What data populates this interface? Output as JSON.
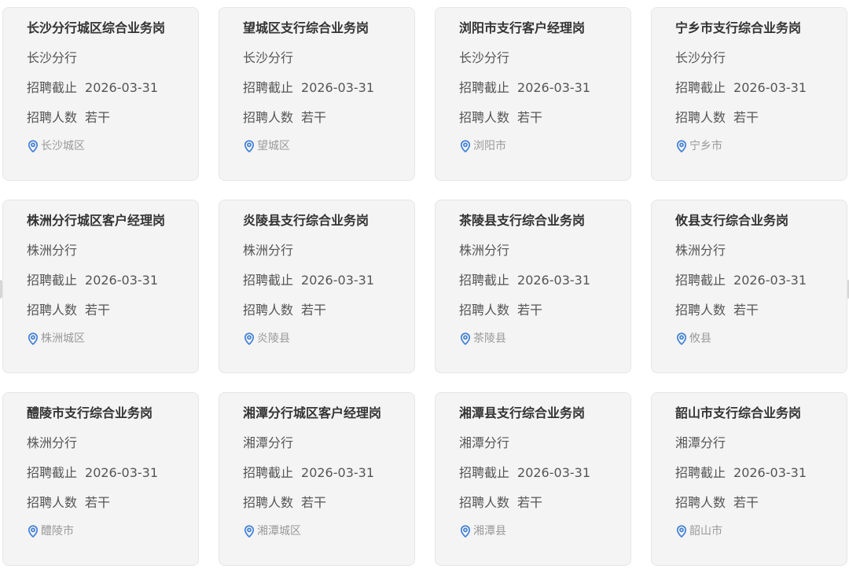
{
  "labels": {
    "deadline": "招聘截止",
    "headcount": "招聘人数"
  },
  "colors": {
    "card_bg": "#f4f4f4",
    "pin_icon": "#3f7fd6"
  },
  "jobs": [
    {
      "title": "长沙分行城区综合业务岗",
      "branch": "长沙分行",
      "deadline": "2026-03-31",
      "headcount": "若干",
      "location": "长沙城区"
    },
    {
      "title": "望城区支行综合业务岗",
      "branch": "长沙分行",
      "deadline": "2026-03-31",
      "headcount": "若干",
      "location": "望城区"
    },
    {
      "title": "浏阳市支行客户经理岗",
      "branch": "长沙分行",
      "deadline": "2026-03-31",
      "headcount": "若干",
      "location": "浏阳市"
    },
    {
      "title": "宁乡市支行综合业务岗",
      "branch": "长沙分行",
      "deadline": "2026-03-31",
      "headcount": "若干",
      "location": "宁乡市"
    },
    {
      "title": "株洲分行城区客户经理岗",
      "branch": "株洲分行",
      "deadline": "2026-03-31",
      "headcount": "若干",
      "location": "株洲城区"
    },
    {
      "title": "炎陵县支行综合业务岗",
      "branch": "株洲分行",
      "deadline": "2026-03-31",
      "headcount": "若干",
      "location": "炎陵县"
    },
    {
      "title": "茶陵县支行综合业务岗",
      "branch": "株洲分行",
      "deadline": "2026-03-31",
      "headcount": "若干",
      "location": "茶陵县"
    },
    {
      "title": "攸县支行综合业务岗",
      "branch": "株洲分行",
      "deadline": "2026-03-31",
      "headcount": "若干",
      "location": "攸县"
    },
    {
      "title": "醴陵市支行综合业务岗",
      "branch": "株洲分行",
      "deadline": "2026-03-31",
      "headcount": "若干",
      "location": "醴陵市"
    },
    {
      "title": "湘潭分行城区客户经理岗",
      "branch": "湘潭分行",
      "deadline": "2026-03-31",
      "headcount": "若干",
      "location": "湘潭城区"
    },
    {
      "title": "湘潭县支行综合业务岗",
      "branch": "湘潭分行",
      "deadline": "2026-03-31",
      "headcount": "若干",
      "location": "湘潭县"
    },
    {
      "title": "韶山市支行综合业务岗",
      "branch": "湘潭分行",
      "deadline": "2026-03-31",
      "headcount": "若干",
      "location": "韶山市"
    }
  ]
}
